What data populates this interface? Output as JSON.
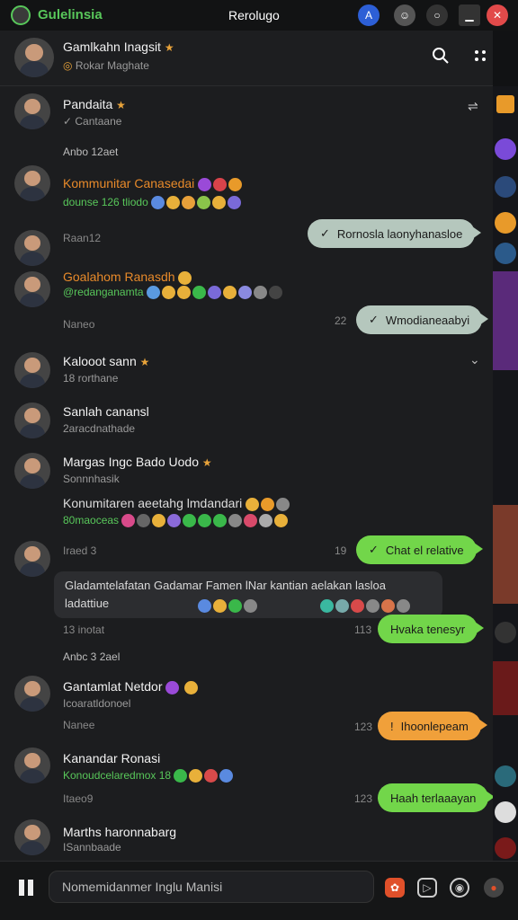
{
  "app": {
    "name": "Gulelinsia",
    "window_title": "Rerolugo"
  },
  "header": {
    "name": "Gamlkahn Inagsit",
    "status": "Rokar Maghate"
  },
  "chat": {
    "contacts": [
      {
        "name": "Pandaita",
        "sub": "Cantaane"
      },
      {
        "name": "Kommunitar Canasedai",
        "sub": "dounse 126 tliodo"
      },
      {
        "name": "Goalahom Ranasdh",
        "sub": "@redanganamta"
      },
      {
        "name": "Kalooot sann",
        "sub": "18 rorthane"
      },
      {
        "name": "Sanlah canansl",
        "sub": "2aracdnathade"
      },
      {
        "name": "Margas Ingc Bado Uodo",
        "sub": "Sonnnhasik"
      },
      {
        "name": "Konumitaren aeetahg lmdandari",
        "sub": "80maoceas"
      },
      {
        "name": "Gantamlat Netdor",
        "sub": "Icoaratldonoel"
      },
      {
        "name": "Kanandar Ronasi",
        "sub": "Konoudcelaredmox 18"
      },
      {
        "name": "Marths haronnabarg",
        "sub": "ISannbaade"
      }
    ],
    "date_separators": [
      "Anbo 12aet",
      "Anbc 3 2ael"
    ],
    "meta": [
      "Raan12",
      "Naneo",
      "Iraed 3",
      "13 inotat",
      "Nanee",
      "Itaeo9",
      "22",
      "19",
      "113",
      "123",
      "123"
    ],
    "bubbles": [
      {
        "text": "Rornosla laonyhanasloe",
        "check": "✓"
      },
      {
        "text": "Wmodianeaabyi",
        "check": "✓"
      },
      {
        "text": "Chat el relative",
        "check": "✓"
      },
      {
        "text": "Hvaka tenesyr",
        "check": ""
      },
      {
        "text": "Ihoonlepeam",
        "check": "!"
      },
      {
        "text": "Haah terlaaayan",
        "check": ""
      }
    ],
    "long_message": "Gladamtelafatan Gadamar Famen lNar kantian aelakan lasloa ladattiue"
  },
  "footer": {
    "placeholder": "Nomemidanmer Inglu Manisi"
  },
  "colors": {
    "accent_green": "#58c75a",
    "bubble_green": "#72d64a",
    "bubble_orange": "#f0a03a",
    "bubble_gray": "#b5c7bd"
  },
  "icons": [
    "search-icon",
    "more-icon",
    "pause-icon",
    "close-icon"
  ]
}
